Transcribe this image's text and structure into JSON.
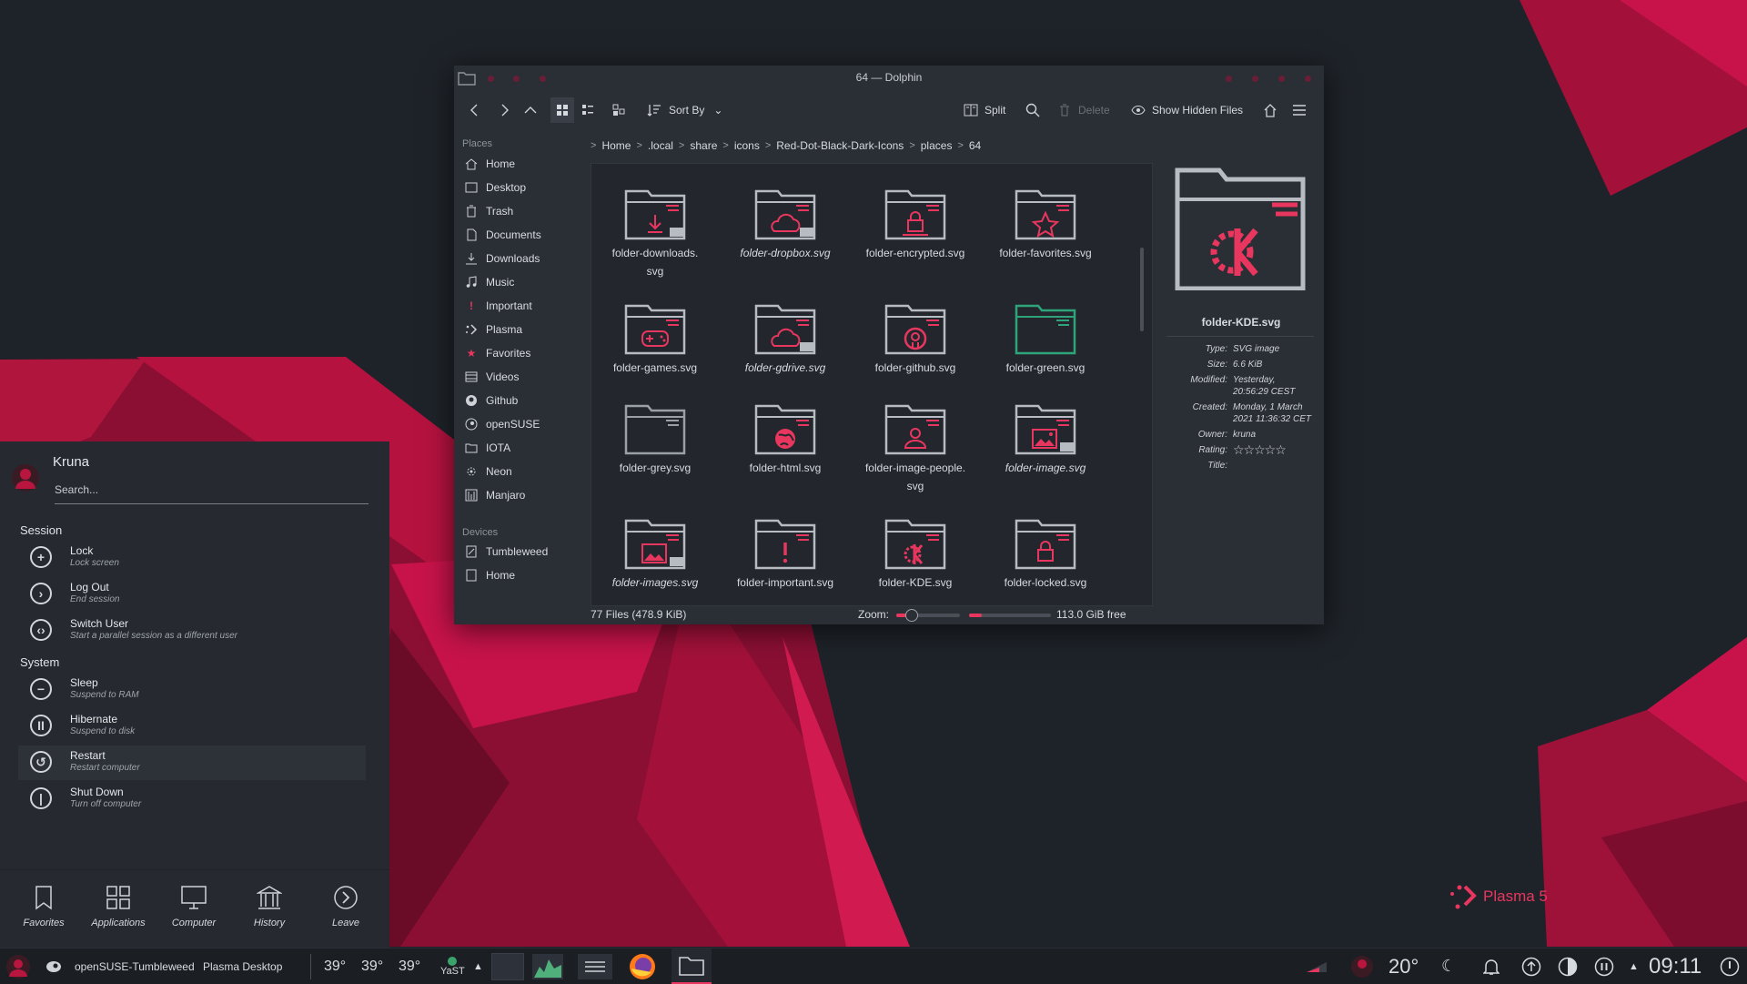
{
  "window": {
    "title": "64 — Dolphin",
    "toolbar": {
      "sort_by": "Sort By",
      "split": "Split",
      "delete": "Delete",
      "show_hidden": "Show Hidden Files"
    },
    "places": {
      "header": "Places",
      "items": [
        "Home",
        "Desktop",
        "Trash",
        "Documents",
        "Downloads",
        "Music",
        "Important",
        "Plasma",
        "Favorites",
        "Videos",
        "Github",
        "openSUSE",
        "IOTA",
        "Neon",
        "Manjaro"
      ],
      "devices_header": "Devices",
      "devices": [
        "Tumbleweed",
        "Home"
      ]
    },
    "breadcrumbs": [
      "Home",
      ".local",
      "share",
      "icons",
      "Red-Dot-Black-Dark-Icons",
      "places",
      "64"
    ],
    "files": [
      {
        "line1": "folder-downloads.",
        "line2": "svg"
      },
      {
        "line1": "folder-dropbox.svg",
        "line2": ""
      },
      {
        "line1": "folder-encrypted.svg",
        "line2": ""
      },
      {
        "line1": "folder-favorites.svg",
        "line2": ""
      },
      {
        "line1": "folder-games.svg",
        "line2": ""
      },
      {
        "line1": "folder-gdrive.svg",
        "line2": ""
      },
      {
        "line1": "folder-github.svg",
        "line2": ""
      },
      {
        "line1": "folder-green.svg",
        "line2": ""
      },
      {
        "line1": "folder-grey.svg",
        "line2": ""
      },
      {
        "line1": "folder-html.svg",
        "line2": ""
      },
      {
        "line1": "folder-image-people.",
        "line2": "svg"
      },
      {
        "line1": "folder-image.svg",
        "line2": ""
      },
      {
        "line1": "folder-images.svg",
        "line2": ""
      },
      {
        "line1": "folder-important.svg",
        "line2": ""
      },
      {
        "line1": "folder-KDE.svg",
        "line2": ""
      },
      {
        "line1": "folder-locked.svg",
        "line2": ""
      }
    ],
    "info": {
      "name": "folder-KDE.svg",
      "type_label": "Type:",
      "type": "SVG image",
      "size_label": "Size:",
      "size": "6.6 KiB",
      "modified_label": "Modified:",
      "modified1": "Yesterday,",
      "modified2": "20:56:29 CEST",
      "created_label": "Created:",
      "created1": "Monday, 1 March",
      "created2": "2021 11:36:32 CET",
      "owner_label": "Owner:",
      "owner": "kruna",
      "rating_label": "Rating:",
      "rating": "☆☆☆☆☆",
      "title_label": "Title:"
    },
    "status": {
      "count": "77 Files (478.9 KiB)",
      "zoom_label": "Zoom:",
      "free": "113.0 GiB free"
    }
  },
  "launcher": {
    "user": "Kruna",
    "search_placeholder": "Search...",
    "session_header": "Session",
    "system_header": "System",
    "actions": [
      {
        "title": "Lock",
        "sub": "Lock screen"
      },
      {
        "title": "Log Out",
        "sub": "End session"
      },
      {
        "title": "Switch User",
        "sub": "Start a parallel session as a different user"
      },
      {
        "title": "Sleep",
        "sub": "Suspend to RAM"
      },
      {
        "title": "Hibernate",
        "sub": "Suspend to disk"
      },
      {
        "title": "Restart",
        "sub": "Restart computer"
      },
      {
        "title": "Shut Down",
        "sub": "Turn off computer"
      }
    ],
    "tabs": [
      "Favorites",
      "Applications",
      "Computer",
      "History",
      "Leave"
    ]
  },
  "taskbar": {
    "host": "openSUSE-Tumbleweed",
    "activity": "Plasma Desktop",
    "temps": [
      "39°",
      "39°",
      "39°"
    ],
    "yast": "YaST",
    "weather": "20°",
    "clock": "09:11"
  },
  "brand": "Plasma 5",
  "colors": {
    "accent": "#e8365f",
    "bg": "#1f242b",
    "window": "#2a2e35"
  }
}
